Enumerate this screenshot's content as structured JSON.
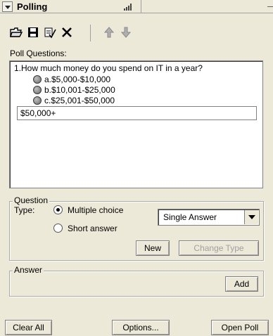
{
  "panel": {
    "title": "Polling"
  },
  "toolbar": {
    "icons": [
      "open-icon",
      "save-icon",
      "spell-check-icon",
      "delete-icon",
      "move-up-icon",
      "move-down-icon"
    ]
  },
  "poll": {
    "label": "Poll Questions:",
    "question": "1.How much money do you spend on IT in a year?",
    "options": [
      "a.$5,000-$10,000",
      "b.$10,001-$25,000",
      "c.$25,001-$50,000"
    ],
    "new_answer_value": "$50,000+"
  },
  "question_group": {
    "legend": "Question",
    "type_label": "Type:",
    "types": [
      "Multiple choice",
      "Short answer"
    ],
    "selected_type": "Multiple choice",
    "answer_mode": "Single Answer",
    "new_label": "New",
    "change_type_label": "Change Type"
  },
  "answer_group": {
    "legend": "Answer",
    "add_label": "Add"
  },
  "footer": {
    "clear_all_label": "Clear All",
    "options_label": "Options...",
    "open_poll_label": "Open Poll"
  }
}
